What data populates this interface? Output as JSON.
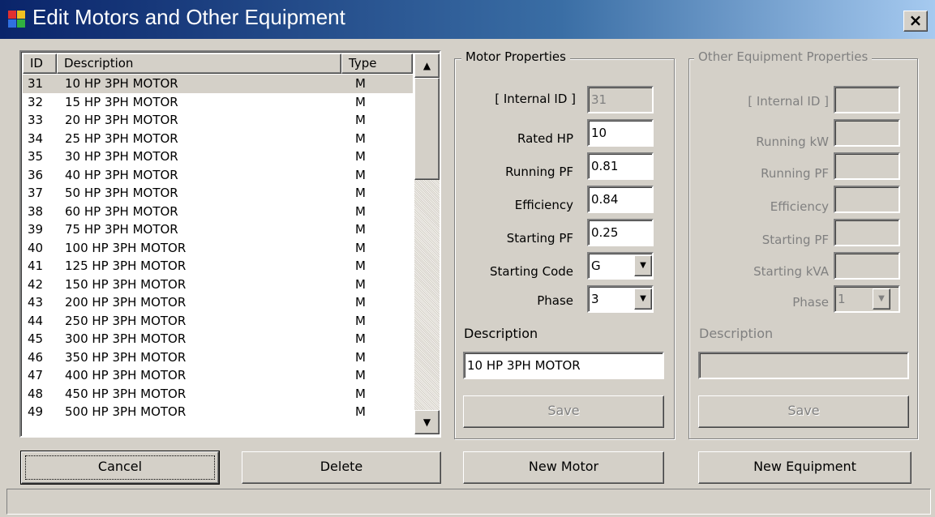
{
  "window": {
    "title": "Edit Motors and Other Equipment",
    "close_label": "×"
  },
  "list": {
    "columns": [
      "ID",
      "Description",
      "Type"
    ],
    "rows": [
      {
        "id": "31",
        "desc": "10 HP 3PH MOTOR",
        "type": "M"
      },
      {
        "id": "32",
        "desc": "15 HP 3PH MOTOR",
        "type": "M"
      },
      {
        "id": "33",
        "desc": "20 HP 3PH MOTOR",
        "type": "M"
      },
      {
        "id": "34",
        "desc": "25 HP 3PH MOTOR",
        "type": "M"
      },
      {
        "id": "35",
        "desc": "30 HP 3PH MOTOR",
        "type": "M"
      },
      {
        "id": "36",
        "desc": "40 HP 3PH MOTOR",
        "type": "M"
      },
      {
        "id": "37",
        "desc": "50 HP 3PH MOTOR",
        "type": "M"
      },
      {
        "id": "38",
        "desc": "60 HP 3PH MOTOR",
        "type": "M"
      },
      {
        "id": "39",
        "desc": "75 HP 3PH MOTOR",
        "type": "M"
      },
      {
        "id": "40",
        "desc": "100 HP 3PH MOTOR",
        "type": "M"
      },
      {
        "id": "41",
        "desc": "125 HP 3PH MOTOR",
        "type": "M"
      },
      {
        "id": "42",
        "desc": "150 HP 3PH MOTOR",
        "type": "M"
      },
      {
        "id": "43",
        "desc": "200 HP 3PH MOTOR",
        "type": "M"
      },
      {
        "id": "44",
        "desc": "250 HP 3PH MOTOR",
        "type": "M"
      },
      {
        "id": "45",
        "desc": "300 HP 3PH MOTOR",
        "type": "M"
      },
      {
        "id": "46",
        "desc": "350 HP 3PH MOTOR",
        "type": "M"
      },
      {
        "id": "47",
        "desc": "400 HP 3PH MOTOR",
        "type": "M"
      },
      {
        "id": "48",
        "desc": "450 HP 3PH MOTOR",
        "type": "M"
      },
      {
        "id": "49",
        "desc": "500 HP 3PH MOTOR",
        "type": "M"
      }
    ],
    "selected_id": "31",
    "scroll_up": "▲",
    "scroll_down": "▼"
  },
  "motor": {
    "legend": "Motor Properties",
    "internal_id_label": "[ Internal ID ]",
    "internal_id": "31",
    "rated_hp_label": "Rated HP",
    "rated_hp": "10",
    "running_pf_label": "Running PF",
    "running_pf": "0.81",
    "efficiency_label": "Efficiency",
    "efficiency": "0.84",
    "starting_pf_label": "Starting PF",
    "starting_pf": "0.25",
    "starting_code_label": "Starting Code",
    "starting_code": "G",
    "phase_label": "Phase",
    "phase": "3",
    "description_label": "Description",
    "description": "10 HP 3PH MOTOR",
    "save_label": "Save"
  },
  "equipment": {
    "legend": "Other Equipment Properties",
    "internal_id_label": "[ Internal ID ]",
    "running_kw_label": "Running kW",
    "running_pf_label": "Running PF",
    "efficiency_label": "Efficiency",
    "starting_pf_label": "Starting PF",
    "starting_kva_label": "Starting kVA",
    "phase_label": "Phase",
    "phase": "1",
    "description_label": "Description",
    "save_label": "Save"
  },
  "combo_arrow": "▼",
  "buttons": {
    "cancel": "Cancel",
    "delete": "Delete",
    "new_motor": "New Motor",
    "new_equipment": "New Equipment"
  },
  "colors": {
    "titlebar_start": "#0a246a",
    "face": "#d4d0c8",
    "disabled_text": "#808080"
  },
  "icons": {
    "app": "app-icon",
    "close": "close-icon"
  }
}
